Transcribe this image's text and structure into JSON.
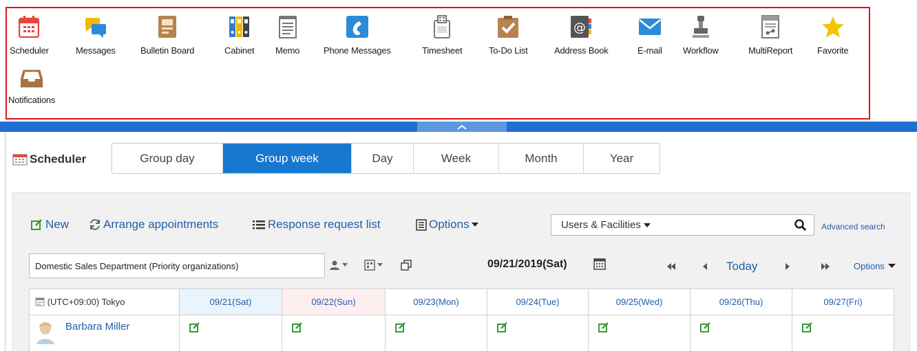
{
  "app_menu": {
    "items": [
      {
        "label": "Scheduler",
        "icon": "calendar-icon"
      },
      {
        "label": "Messages",
        "icon": "chat-bubbles-icon"
      },
      {
        "label": "Bulletin Board",
        "icon": "bulletin-board-icon"
      },
      {
        "label": "Cabinet",
        "icon": "binders-icon"
      },
      {
        "label": "Memo",
        "icon": "memo-pad-icon"
      },
      {
        "label": "Phone Messages",
        "icon": "phone-icon"
      },
      {
        "label": "Timesheet",
        "icon": "timecard-icon"
      },
      {
        "label": "To-Do List",
        "icon": "checkbox-icon"
      },
      {
        "label": "Address Book",
        "icon": "at-sign-book-icon"
      },
      {
        "label": "E-mail",
        "icon": "envelope-icon"
      },
      {
        "label": "Workflow",
        "icon": "stamp-icon"
      },
      {
        "label": "MultiReport",
        "icon": "report-icon"
      },
      {
        "label": "Favorite",
        "icon": "star-icon"
      },
      {
        "label": "Notifications",
        "icon": "inbox-tray-icon"
      }
    ]
  },
  "scheduler": {
    "title": "Scheduler",
    "tabs": [
      "Group day",
      "Group week",
      "Day",
      "Week",
      "Month",
      "Year"
    ],
    "active_tab": "Group week"
  },
  "toolbar": {
    "new_label": "New",
    "arrange_label": "Arrange appointments",
    "response_label": "Response request list",
    "options_label": "Options",
    "users_facilities": "Users & Facilities",
    "search_value": "",
    "advanced_search": "Advanced search"
  },
  "nav": {
    "department": "Domestic Sales Department (Priority organizations)",
    "date": "09/21/2019(Sat)",
    "today": "Today",
    "options": "Options"
  },
  "table": {
    "timezone": "(UTC+09:00) Tokyo",
    "days": [
      "09/21(Sat)",
      "09/22(Sun)",
      "09/23(Mon)",
      "09/24(Tue)",
      "09/25(Wed)",
      "09/26(Thu)",
      "09/27(Fri)"
    ],
    "rows": [
      {
        "user": "Barbara Miller"
      }
    ]
  },
  "colors": {
    "accent_blue": "#1778d1",
    "link_blue": "#1f5fa8",
    "highlight_red": "#e0141b",
    "saturday_bg": "#eaf4fd",
    "sunday_bg": "#fdeff0"
  }
}
